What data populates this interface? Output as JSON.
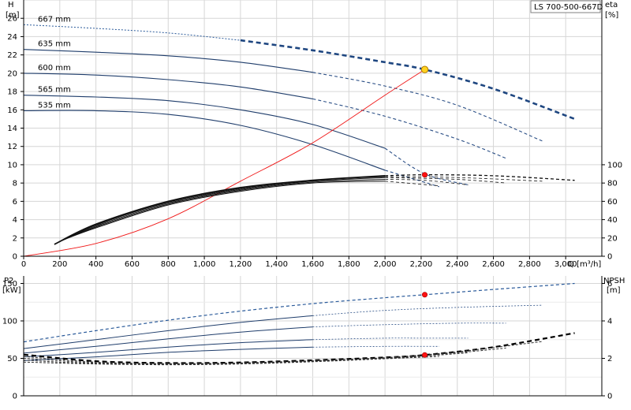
{
  "chart_data": [
    {
      "type": "line",
      "model": "LS 700-500-667D",
      "xlabel": "Q [m³/h]",
      "ylabel_left": [
        "H",
        "[m]"
      ],
      "ylabel_right": [
        "eta",
        "[%]"
      ],
      "xlim": [
        0,
        3200
      ],
      "ylim_left": [
        0,
        28
      ],
      "ylim_right": [
        0,
        280
      ],
      "xticks": [
        0,
        200,
        400,
        600,
        800,
        1000,
        1200,
        1400,
        1600,
        1800,
        2000,
        2200,
        2400,
        2600,
        2800,
        3000
      ],
      "xtick_labels": [
        "0",
        "200",
        "400",
        "600",
        "800",
        "1,000",
        "1,200",
        "1,400",
        "1,600",
        "1,800",
        "2,000",
        "2,200",
        "2,400",
        "2,600",
        "2,800",
        "3,000"
      ],
      "yticks_left": [
        0,
        2,
        4,
        6,
        8,
        10,
        12,
        14,
        16,
        18,
        20,
        22,
        24,
        26
      ],
      "yticks_right": [
        0,
        20,
        40,
        60,
        80,
        100
      ],
      "grid": true,
      "head_curves": [
        {
          "name": "667 mm",
          "x": [
            0,
            400,
            800,
            1200,
            1600,
            2000,
            2220,
            2600,
            3050
          ],
          "y": [
            25.3,
            24.9,
            24.4,
            23.6,
            22.5,
            21.2,
            20.4,
            18.3,
            15.0
          ]
        },
        {
          "name": "635 mm",
          "x": [
            0,
            400,
            800,
            1200,
            1600,
            2000,
            2400,
            2870
          ],
          "y": [
            22.6,
            22.3,
            21.9,
            21.2,
            20.1,
            18.6,
            16.5,
            12.6
          ]
        },
        {
          "name": "600 mm",
          "x": [
            0,
            400,
            800,
            1200,
            1600,
            2000,
            2400,
            2670
          ],
          "y": [
            20.0,
            19.8,
            19.3,
            18.5,
            17.2,
            15.3,
            12.8,
            10.7
          ]
        },
        {
          "name": "565 mm",
          "x": [
            0,
            400,
            800,
            1200,
            1600,
            2000,
            2220,
            2460
          ],
          "y": [
            17.6,
            17.4,
            17.0,
            16.0,
            14.4,
            11.8,
            9.0,
            7.8
          ]
        },
        {
          "name": "535 mm",
          "x": [
            0,
            400,
            800,
            1200,
            1600,
            2000,
            2300
          ],
          "y": [
            15.9,
            15.9,
            15.5,
            14.3,
            12.2,
            9.4,
            7.6
          ]
        }
      ],
      "system_curve": {
        "x": [
          0,
          400,
          800,
          1200,
          1600,
          2000,
          2220
        ],
        "y": [
          0,
          1.4,
          4.1,
          8.2,
          12.4,
          17.6,
          20.4
        ]
      },
      "efficiency_curves": [
        {
          "x": [
            170,
            400,
            800,
            1200,
            1600,
            2000,
            2220,
            2600,
            3050
          ],
          "y": [
            13,
            35,
            60,
            75,
            83,
            88,
            89,
            88,
            83
          ]
        },
        {
          "x": [
            190,
            400,
            800,
            1200,
            1600,
            2000,
            2400,
            2870
          ],
          "y": [
            15,
            34,
            59,
            74,
            83,
            87,
            86,
            82
          ]
        },
        {
          "x": [
            200,
            400,
            800,
            1200,
            1600,
            2000,
            2400,
            2670
          ],
          "y": [
            16,
            33,
            58,
            73,
            82,
            86,
            84,
            80
          ]
        },
        {
          "x": [
            210,
            400,
            800,
            1200,
            1600,
            2000,
            2220,
            2460
          ],
          "y": [
            17,
            32,
            57,
            72,
            81,
            84,
            83,
            78
          ]
        },
        {
          "x": [
            220,
            400,
            800,
            1200,
            1600,
            2000,
            2300
          ],
          "y": [
            18,
            31,
            56,
            71,
            80,
            82,
            77
          ]
        }
      ],
      "duty_point": {
        "x": 2220,
        "y": 20.4
      },
      "efficiency_point": {
        "x": 2220,
        "y": 89
      }
    },
    {
      "type": "line",
      "xlim": [
        0,
        3200
      ],
      "ylabel_left": [
        "P2",
        "[kW]"
      ],
      "ylabel_right": [
        "NPSH",
        "[m]"
      ],
      "ylim_left": [
        0,
        160
      ],
      "ylim_right": [
        0,
        6.4
      ],
      "yticks_left": [
        0,
        50,
        100,
        150
      ],
      "yticks_right": [
        0,
        2,
        4,
        6
      ],
      "grid": true,
      "power_curves": [
        {
          "x": [
            0,
            400,
            800,
            1200,
            1600,
            2000,
            2220,
            2600,
            3050
          ],
          "y": [
            72,
            87,
            101,
            113,
            123,
            131,
            135,
            142,
            150
          ]
        },
        {
          "x": [
            0,
            400,
            800,
            1200,
            1600,
            2000,
            2400,
            2870
          ],
          "y": [
            63,
            75,
            87,
            98,
            107,
            114,
            118,
            121
          ]
        },
        {
          "x": [
            0,
            400,
            800,
            1200,
            1600,
            2000,
            2400,
            2670
          ],
          "y": [
            57,
            66,
            76,
            85,
            92,
            95,
            97,
            97
          ]
        },
        {
          "x": [
            0,
            400,
            800,
            1200,
            1600,
            2000,
            2220,
            2460
          ],
          "y": [
            52,
            58,
            65,
            71,
            75,
            77,
            77,
            77
          ]
        },
        {
          "x": [
            0,
            400,
            800,
            1200,
            1600,
            2000,
            2300
          ],
          "y": [
            47,
            52,
            58,
            62,
            65,
            66,
            66
          ]
        }
      ],
      "npsh_curves": [
        {
          "x": [
            0,
            400,
            800,
            1200,
            1600,
            2000,
            2220,
            2600,
            3050
          ],
          "y": [
            2.2,
            1.85,
            1.75,
            1.78,
            1.9,
            2.05,
            2.18,
            2.6,
            3.35
          ]
        },
        {
          "x": [
            0,
            400,
            800,
            1200,
            1600,
            2000,
            2400,
            2870
          ],
          "y": [
            2.1,
            1.8,
            1.72,
            1.76,
            1.88,
            2.04,
            2.35,
            2.9
          ]
        },
        {
          "x": [
            0,
            400,
            800,
            1200,
            1600,
            2000,
            2400,
            2670
          ],
          "y": [
            2.0,
            1.76,
            1.7,
            1.74,
            1.86,
            2.02,
            2.3,
            2.55
          ]
        },
        {
          "x": [
            0,
            400,
            800,
            1200,
            1600,
            2000,
            2220,
            2460
          ],
          "y": [
            1.9,
            1.72,
            1.68,
            1.72,
            1.84,
            2.0,
            2.12,
            2.3
          ]
        },
        {
          "x": [
            0,
            400,
            800,
            1200,
            1600,
            2000,
            2300
          ],
          "y": [
            1.8,
            1.7,
            1.66,
            1.7,
            1.82,
            1.98,
            2.1
          ]
        }
      ],
      "duty_point": {
        "x": 2220,
        "y": 135
      },
      "npsh_point": {
        "x": 2220,
        "y": 2.18
      }
    }
  ]
}
